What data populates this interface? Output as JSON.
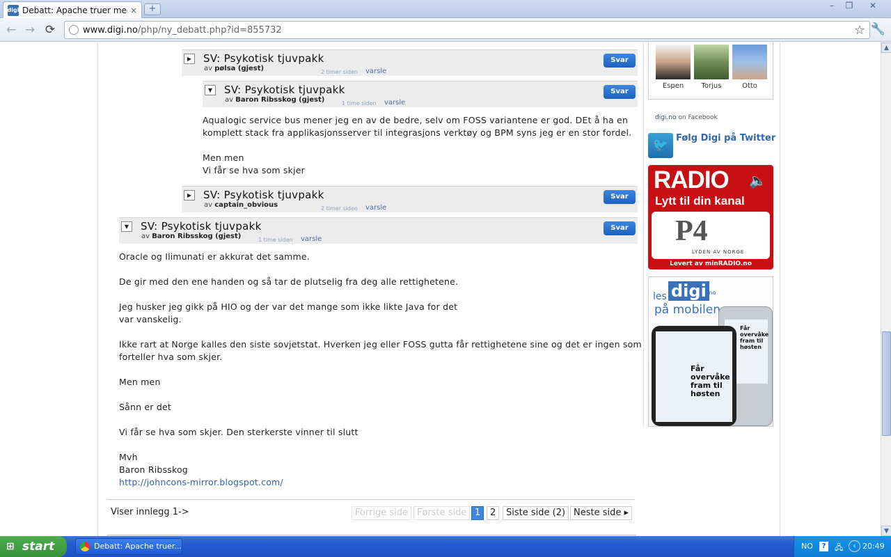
{
  "browser": {
    "tab_title": "Debatt: Apache truer med ...",
    "tab_close": "×",
    "new_tab": "+",
    "favicon_text": "digi",
    "url_host": "www.digi.no",
    "url_path": "/php/ny_debatt.php?id=855732",
    "window_buttons": [
      "–",
      "❐",
      "✕"
    ],
    "nav": {
      "back": "←",
      "forward": "→",
      "reload": "⟳"
    },
    "star_icon": "☆",
    "wrench_icon": "🔧"
  },
  "posts": [
    {
      "title": "SV: Psykotisk tjuvpakk",
      "by_prefix": "av",
      "author": "pølsa (gjest)",
      "time": "2 timer siden",
      "report": "varsle",
      "reply": "Svar",
      "toggle": "▶",
      "body": []
    },
    {
      "title": "SV: Psykotisk tjuvpakk",
      "by_prefix": "av",
      "author": "Baron Ribsskog (gjest)",
      "time": "1 time siden",
      "report": "varsle",
      "reply": "Svar",
      "toggle": "▼",
      "body": [
        "Aqualogic service bus mener jeg en av de bedre, selv om FOSS variantene er god. DEt å ha en",
        "komplett stack fra applikasjonsserver til integrasjons verktøy og BPM syns jeg er en stor fordel.",
        "",
        "Men men",
        "Vi får se hva som skjer"
      ]
    },
    {
      "title": "SV: Psykotisk tjuvpakk",
      "by_prefix": "av",
      "author": "captain_obvious",
      "time": "2 timer siden",
      "report": "varsle",
      "reply": "Svar",
      "toggle": "▶",
      "body": []
    },
    {
      "title": "SV: Psykotisk tjuvpakk",
      "by_prefix": "av",
      "author": "Baron Ribsskog (gjest)",
      "time": "1 time siden",
      "report": "varsle",
      "reply": "Svar",
      "toggle": "▼",
      "body": [
        "Oracle og Ilimunati er akkurat det samme.",
        "",
        "De gir med den ene handen og så tar de plutselig fra deg alle rettighetene.",
        "",
        "Jeg husker jeg gikk på HIO og der var det mange som ikke likte Java for det",
        "var vanskelig.",
        "",
        "Ikke rart at Norge kalles den siste sovjetstat. Hverken jeg eller FOSS gutta får rettighetene sine og det er ingen som",
        "forteller hva som skjer.",
        "",
        "Men men",
        "",
        "Sånn er det",
        "",
        "Vi får se hva som skjer. Den sterkerste vinner til slutt",
        "",
        "Mvh",
        "Baron Ribsskog"
      ],
      "link": "http://johncons-mirror.blogspot.com/"
    }
  ],
  "pager": {
    "summary": "Viser innlegg 1->",
    "prev": "Forrige side",
    "first": "Første side",
    "pages": [
      "1",
      "2"
    ],
    "current": "1",
    "last": "Siste side (2)",
    "next": "Neste side ▸"
  },
  "sidebar": {
    "people": [
      "Espen",
      "Torjus",
      "Otto"
    ],
    "facebook_site": "digi.no",
    "facebook_suffix": "on Facebook",
    "twitter_icon": "🐦",
    "twitter_text": "Følg Digi på Twitter",
    "radio": {
      "title": "RADIO",
      "subtitle": "Lytt til din kanal",
      "speaker_icon": "🔈",
      "station_tag": "LYDEN AV NORGE",
      "footer": "Levert av minRADIO.no"
    },
    "mobile_ad": {
      "les": "les",
      "brand": "digi",
      "tld": ".no",
      "paa": "på mobilen",
      "headline": "Får overvåke fram til høsten"
    }
  },
  "scrollbar": {
    "up": "▲",
    "down": "▼"
  },
  "taskbar": {
    "start": "start",
    "start_icon": "⊞",
    "item": "Debatt: Apache truer...",
    "lang": "NO",
    "help": "?",
    "net_icon": "🖧",
    "chevron": "‹",
    "clock": "20:49"
  },
  "colors": {
    "accent": "#1b61bd",
    "link": "#3a62a0",
    "radio_red": "#c80f14",
    "header_gray": "#ececec"
  }
}
